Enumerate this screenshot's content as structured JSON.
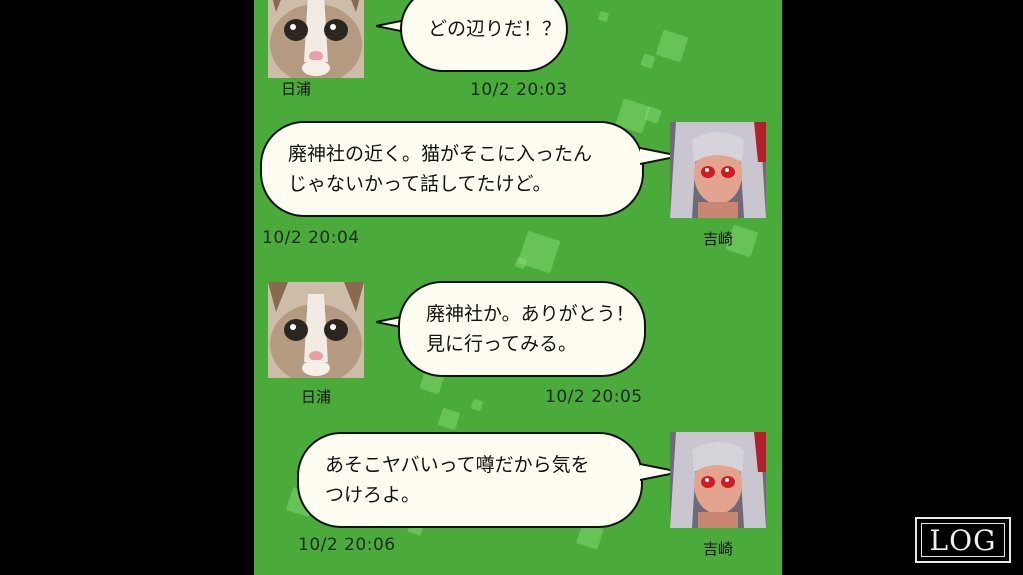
{
  "chat": {
    "messages": [
      {
        "sender": "日浦",
        "avatar": "cat-avatar",
        "lines": [
          "どの辺りだ！？"
        ],
        "timestamp": "10/2  20:03"
      },
      {
        "sender": "吉崎",
        "avatar": "girl-avatar",
        "lines": [
          "廃神社の近く。猫がそこに入ったん",
          "じゃないかって話してたけど。"
        ],
        "timestamp": "10/2  20:04"
      },
      {
        "sender": "日浦",
        "avatar": "cat-avatar",
        "lines": [
          "廃神社か。ありがとう！",
          "見に行ってみる。"
        ],
        "timestamp": "10/2  20:05"
      },
      {
        "sender": "吉崎",
        "avatar": "girl-avatar",
        "lines": [
          "あそこヤバいって噂だから気を",
          "つけろよ。"
        ],
        "timestamp": "10/2  20:06"
      }
    ]
  },
  "controls": {
    "log_label": "LOG"
  },
  "colors": {
    "panel_background": "#4aab3b",
    "bubble_background": "#fffdf1",
    "outer_background": "#000000"
  }
}
